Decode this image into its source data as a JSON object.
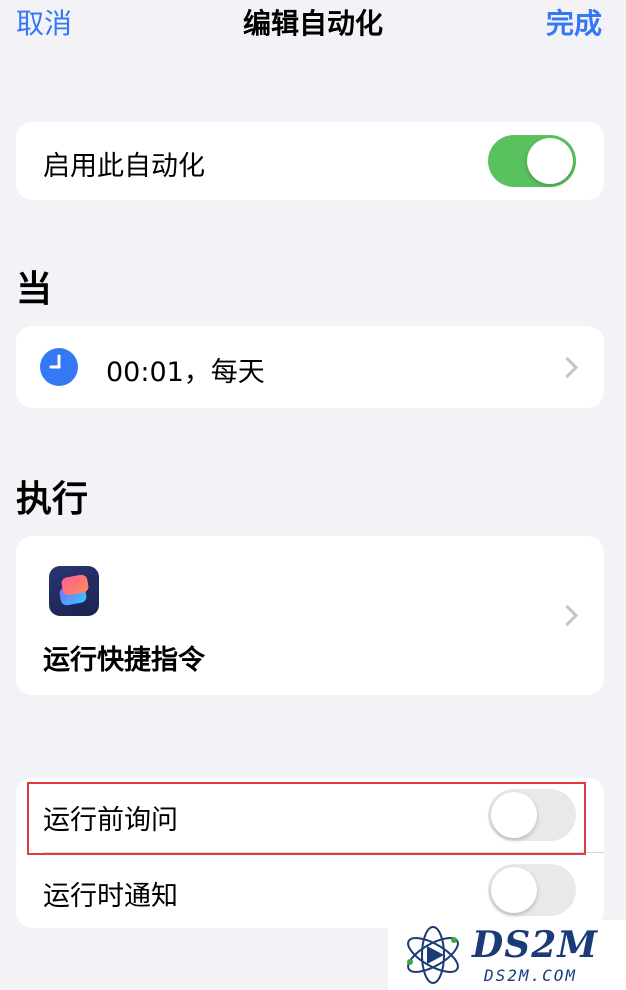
{
  "nav": {
    "cancel_label": "取消",
    "title": "编辑自动化",
    "done_label": "完成"
  },
  "enable_card": {
    "label": "启用此自动化",
    "toggle_on": true
  },
  "when_section": {
    "header": "当",
    "trigger_text": "00:01，每天",
    "icon": "clock-icon"
  },
  "do_section": {
    "header": "执行",
    "action_label": "运行快捷指令",
    "icon": "shortcuts-app-icon"
  },
  "options": {
    "ask_before_running_label": "运行前询问",
    "ask_before_running_on": false,
    "notify_when_run_label": "运行时通知",
    "notify_when_run_on": false
  },
  "watermark": {
    "brand": "DS2M",
    "url": "DS2M.COM"
  },
  "colors": {
    "accent": "#3478f6",
    "toggle_on": "#5ac15f",
    "toggle_off": "#e9e9eb",
    "highlight": "#e23b3b",
    "background": "#f2f2f7"
  }
}
